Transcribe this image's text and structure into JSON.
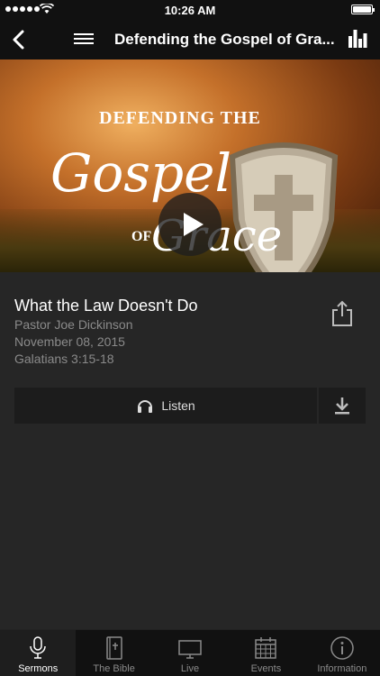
{
  "status_bar": {
    "time": "10:26 AM"
  },
  "nav": {
    "title": "Defending the Gospel of Gra..."
  },
  "hero": {
    "line1": "DEFENDING THE",
    "gospel": "Gospel",
    "of": "OF",
    "grace": "Grace"
  },
  "sermon": {
    "title": "What the Law Doesn't Do",
    "pastor": "Pastor Joe Dickinson",
    "date": "November 08, 2015",
    "reference": "Galatians 3:15-18"
  },
  "actions": {
    "listen_label": "Listen"
  },
  "tabs": [
    {
      "label": "Sermons",
      "icon": "microphone-icon",
      "active": true
    },
    {
      "label": "The Bible",
      "icon": "bible-icon",
      "active": false
    },
    {
      "label": "Live",
      "icon": "tv-icon",
      "active": false
    },
    {
      "label": "Events",
      "icon": "calendar-icon",
      "active": false
    },
    {
      "label": "Information",
      "icon": "info-icon",
      "active": false
    }
  ],
  "colors": {
    "background": "#262626",
    "bar": "#111111",
    "muted_text": "#8a8a8a"
  }
}
